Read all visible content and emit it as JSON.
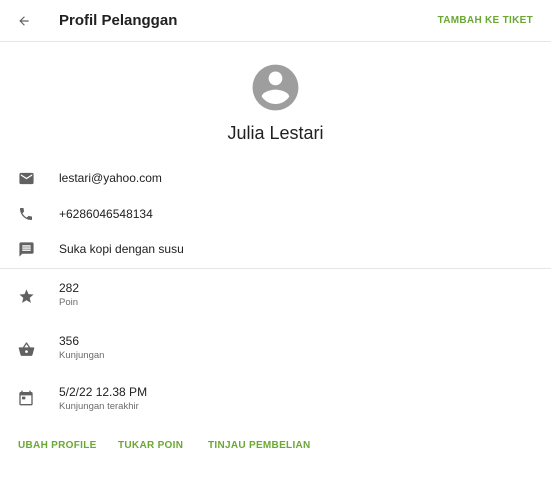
{
  "header": {
    "title": "Profil Pelanggan",
    "add_ticket_label": "TAMBAH KE TIKET"
  },
  "profile": {
    "name": "Julia Lestari"
  },
  "contact": {
    "email": "lestari@yahoo.com",
    "phone": "+6286046548134",
    "note": "Suka kopi dengan susu"
  },
  "stats": {
    "points_value": "282",
    "points_label": "Poin",
    "visits_value": "356",
    "visits_label": "Kunjungan",
    "last_visit_value": "5/2/22 12.38 PM",
    "last_visit_label": "Kunjungan terakhir"
  },
  "actions": {
    "edit_profile": "UBAH PROFILE",
    "redeem_points": "TUKAR POIN",
    "review_purchases": "TINJAU PEMBELIAN"
  },
  "colors": {
    "accent": "#6aa834",
    "icon": "#616161",
    "avatar": "#9e9e9e"
  },
  "icons": {
    "back": "arrow-left-icon",
    "avatar": "account-circle-icon",
    "email": "mail-icon",
    "phone": "phone-icon",
    "note": "message-icon",
    "points": "star-icon",
    "visits": "basket-icon",
    "last_visit": "calendar-icon"
  }
}
